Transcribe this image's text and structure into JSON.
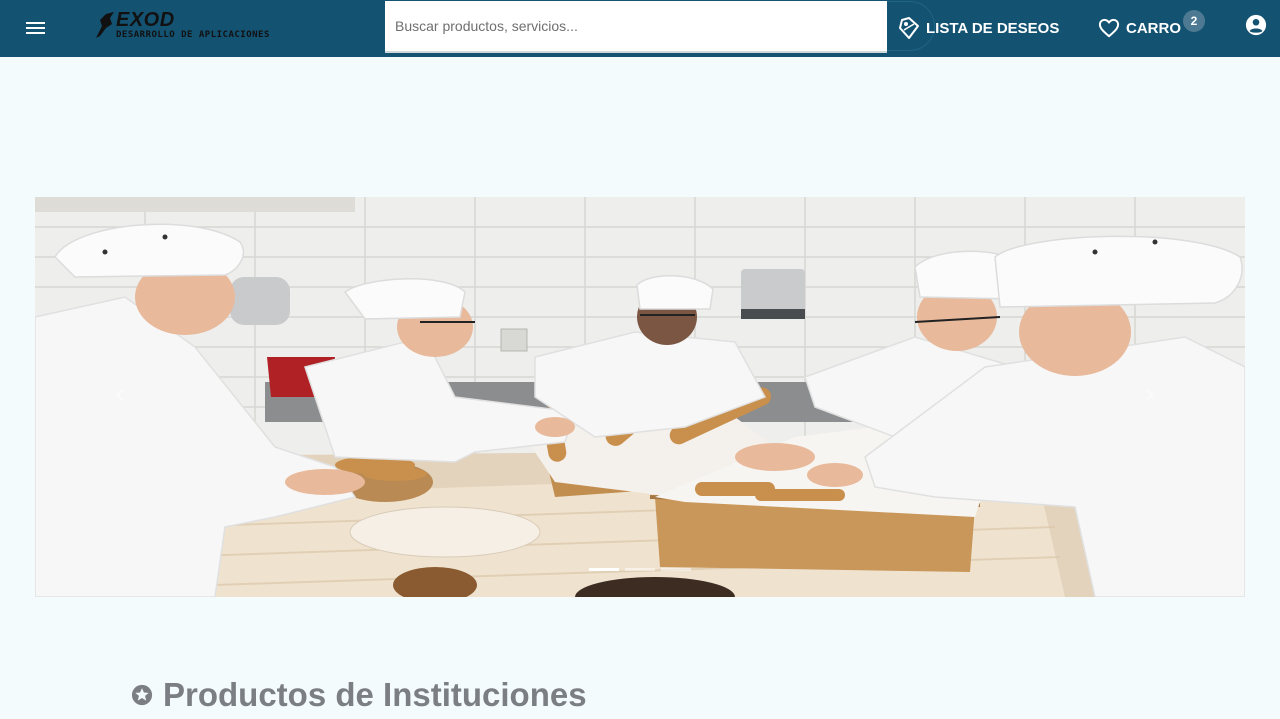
{
  "header": {
    "brand": "EXOD",
    "tagline": "DESARROLLO DE APLICACIONES",
    "search_placeholder": "Buscar productos, servicios...",
    "wishlist_label": "LISTA DE DESEOS",
    "cart_label": "CARRO",
    "cart_count": "2"
  },
  "carousel": {
    "slide_count": 3,
    "active_index": 0
  },
  "section": {
    "title": "Productos de Instituciones"
  },
  "colors": {
    "header_bg": "#145272",
    "page_bg": "#f3fbfd",
    "title_gray": "#7b7e82"
  },
  "icons": [
    "menu-icon",
    "bird-logo-icon",
    "wishlist-tag-icon",
    "heart-icon",
    "account-icon",
    "star-icon",
    "chevron-left-icon",
    "chevron-right-icon"
  ]
}
